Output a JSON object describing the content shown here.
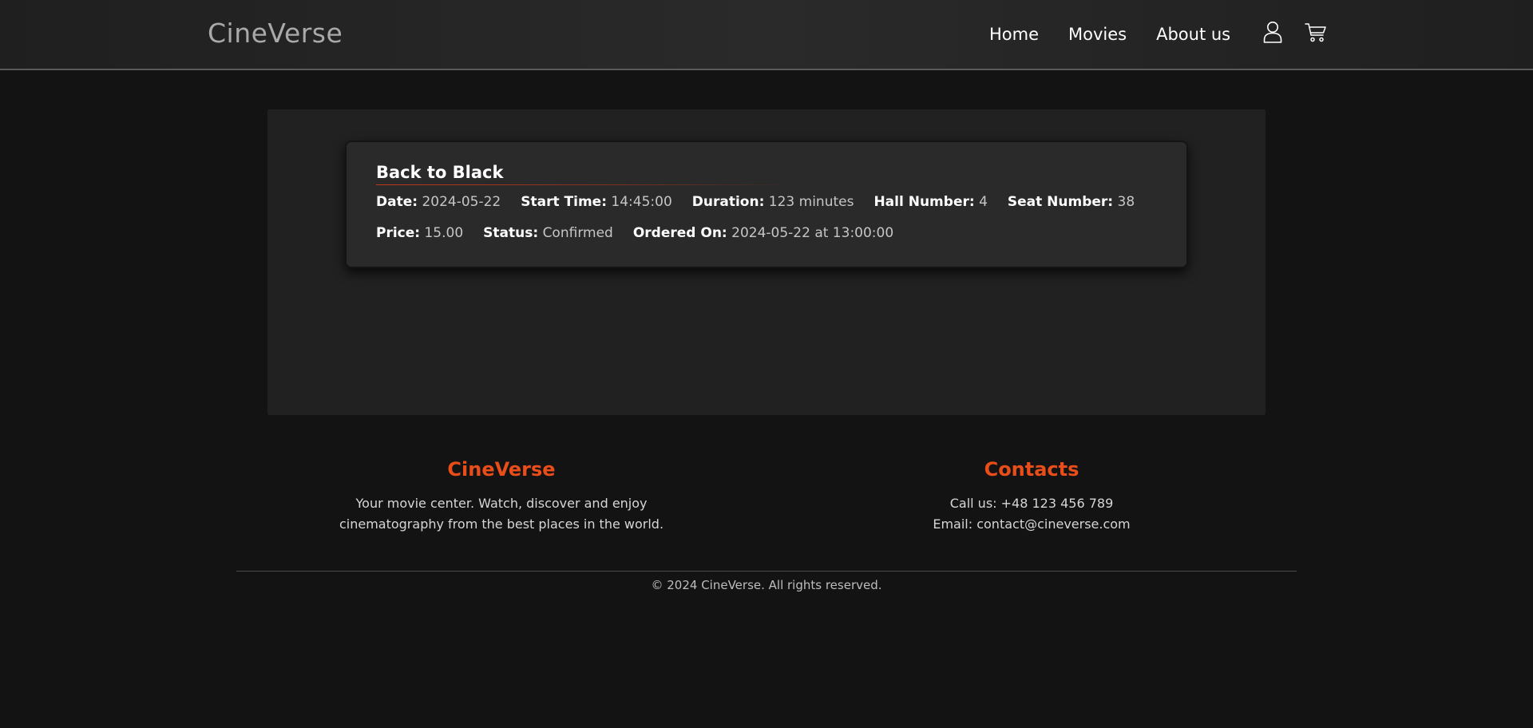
{
  "header": {
    "logo": "CineVerse",
    "nav": [
      "Home",
      "Movies",
      "About us"
    ],
    "icons": [
      "user-icon",
      "cart-icon"
    ]
  },
  "ticket": {
    "title": "Back to Black",
    "row1": [
      {
        "label": "Date:",
        "value": "2024-05-22"
      },
      {
        "label": "Start Time:",
        "value": "14:45:00"
      },
      {
        "label": "Duration:",
        "value": "123 minutes"
      },
      {
        "label": "Hall Number:",
        "value": "4"
      },
      {
        "label": "Seat Number:",
        "value": "38"
      }
    ],
    "row2": [
      {
        "label": "Price:",
        "value": "15.00"
      },
      {
        "label": "Status:",
        "value": "Confirmed"
      },
      {
        "label": "Ordered On:",
        "value": "2024-05-22 at 13:00:00"
      }
    ]
  },
  "footer": {
    "about_title": "CineVerse",
    "about_lines": [
      "Your movie center. Watch, discover and enjoy",
      "cinematography from the best places in the world."
    ],
    "contacts_title": "Contacts",
    "contact_lines": [
      "Call us: +48 123 456 789",
      "Email: contact@cineverse.com"
    ],
    "copyright": "© 2024 CineVerse. All rights reserved."
  },
  "colors": {
    "accent": "#e94d1a",
    "background": "#131313",
    "panel": "#212121",
    "card": "#2a2a2a"
  }
}
